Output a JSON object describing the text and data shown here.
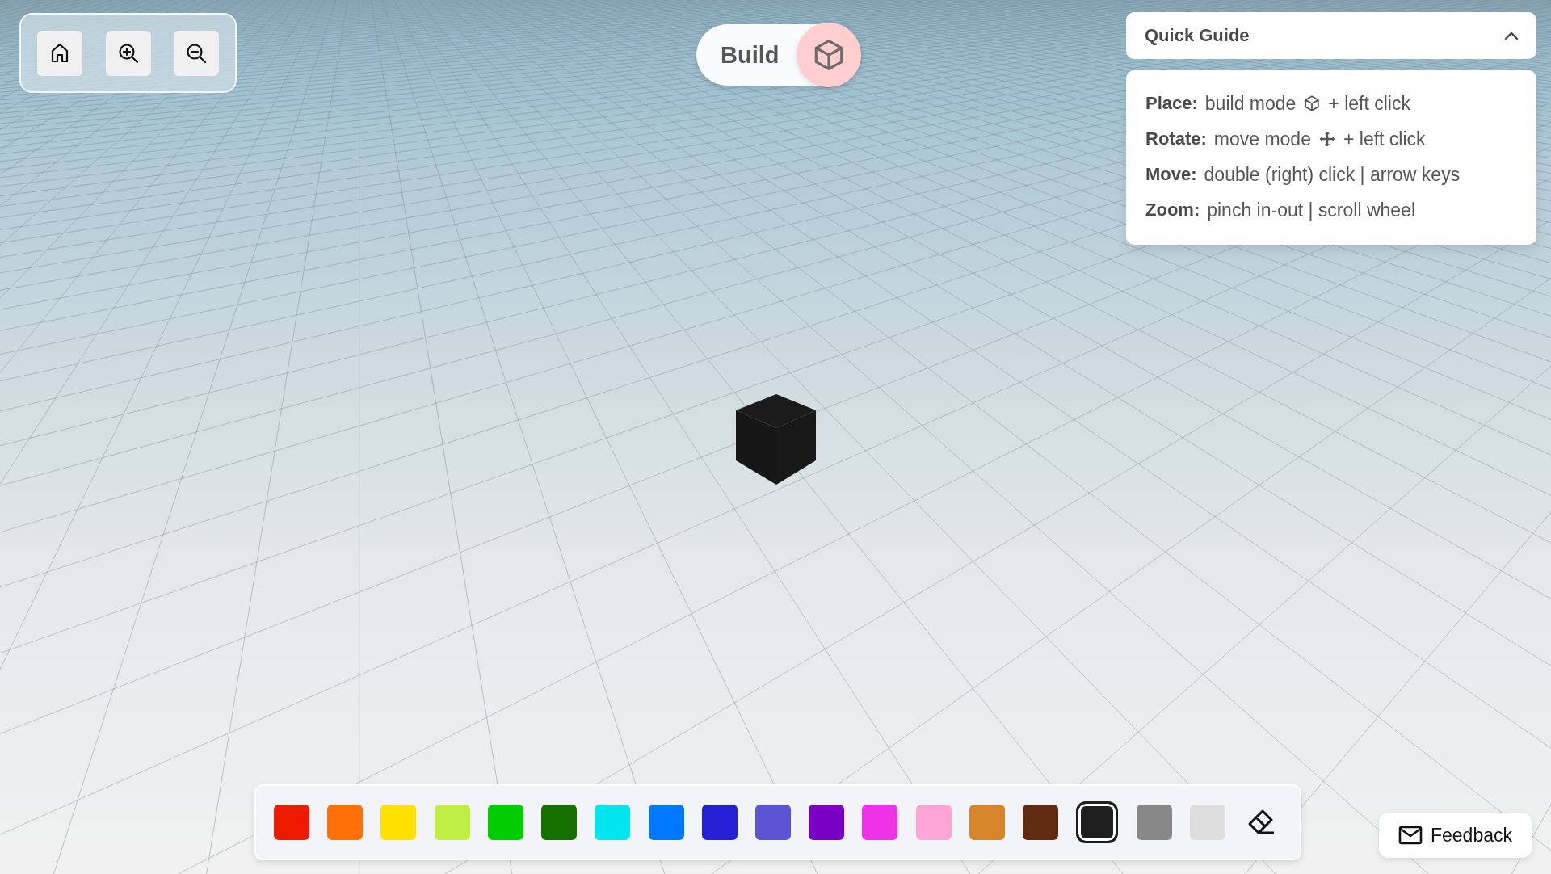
{
  "toolbar": {
    "buttons": [
      {
        "kind": "home"
      },
      {
        "kind": "zoom_in"
      },
      {
        "kind": "zoom_out"
      }
    ]
  },
  "mode_toggle": {
    "label": "Build",
    "kind": "build"
  },
  "quick_guide": {
    "title": "Quick Guide",
    "expanded": true,
    "items": [
      {
        "kind": "build",
        "label": "Place:",
        "text": "build mode",
        "text_after": "+ left click"
      },
      {
        "kind": "move",
        "label": "Rotate:",
        "text": "move mode",
        "text_after": "+ left click"
      },
      {
        "kind": "plain",
        "label": "Move:",
        "text": "double (right) click | arrow keys"
      },
      {
        "kind": "plain",
        "label": "Zoom:",
        "text": "pinch in-out | scroll wheel"
      }
    ]
  },
  "scene": {
    "block": {
      "color": "#1b1b1b"
    }
  },
  "palette": {
    "colors": [
      {
        "color": "#ee1b00",
        "selected": false
      },
      {
        "color": "#ff7009",
        "selected": false
      },
      {
        "color": "#ffe000",
        "selected": false
      },
      {
        "color": "#c0ee44",
        "selected": false
      },
      {
        "color": "#00cc00",
        "selected": false
      },
      {
        "color": "#157000",
        "selected": false
      },
      {
        "color": "#00e5ee",
        "selected": false
      },
      {
        "color": "#0077ff",
        "selected": false
      },
      {
        "color": "#2320d6",
        "selected": false
      },
      {
        "color": "#5b55d6",
        "selected": false
      },
      {
        "color": "#7900c4",
        "selected": false
      },
      {
        "color": "#ee33e6",
        "selected": false
      },
      {
        "color": "#ffa6d6",
        "selected": false
      },
      {
        "color": "#d6852a",
        "selected": false
      },
      {
        "color": "#5e2b10",
        "selected": false
      },
      {
        "color": "#1e1e1e",
        "selected": true
      },
      {
        "color": "#888888",
        "selected": false
      },
      {
        "color": "#dddddd",
        "selected": false
      }
    ],
    "eraser_selected": false
  },
  "feedback": {
    "label": "Feedback"
  }
}
